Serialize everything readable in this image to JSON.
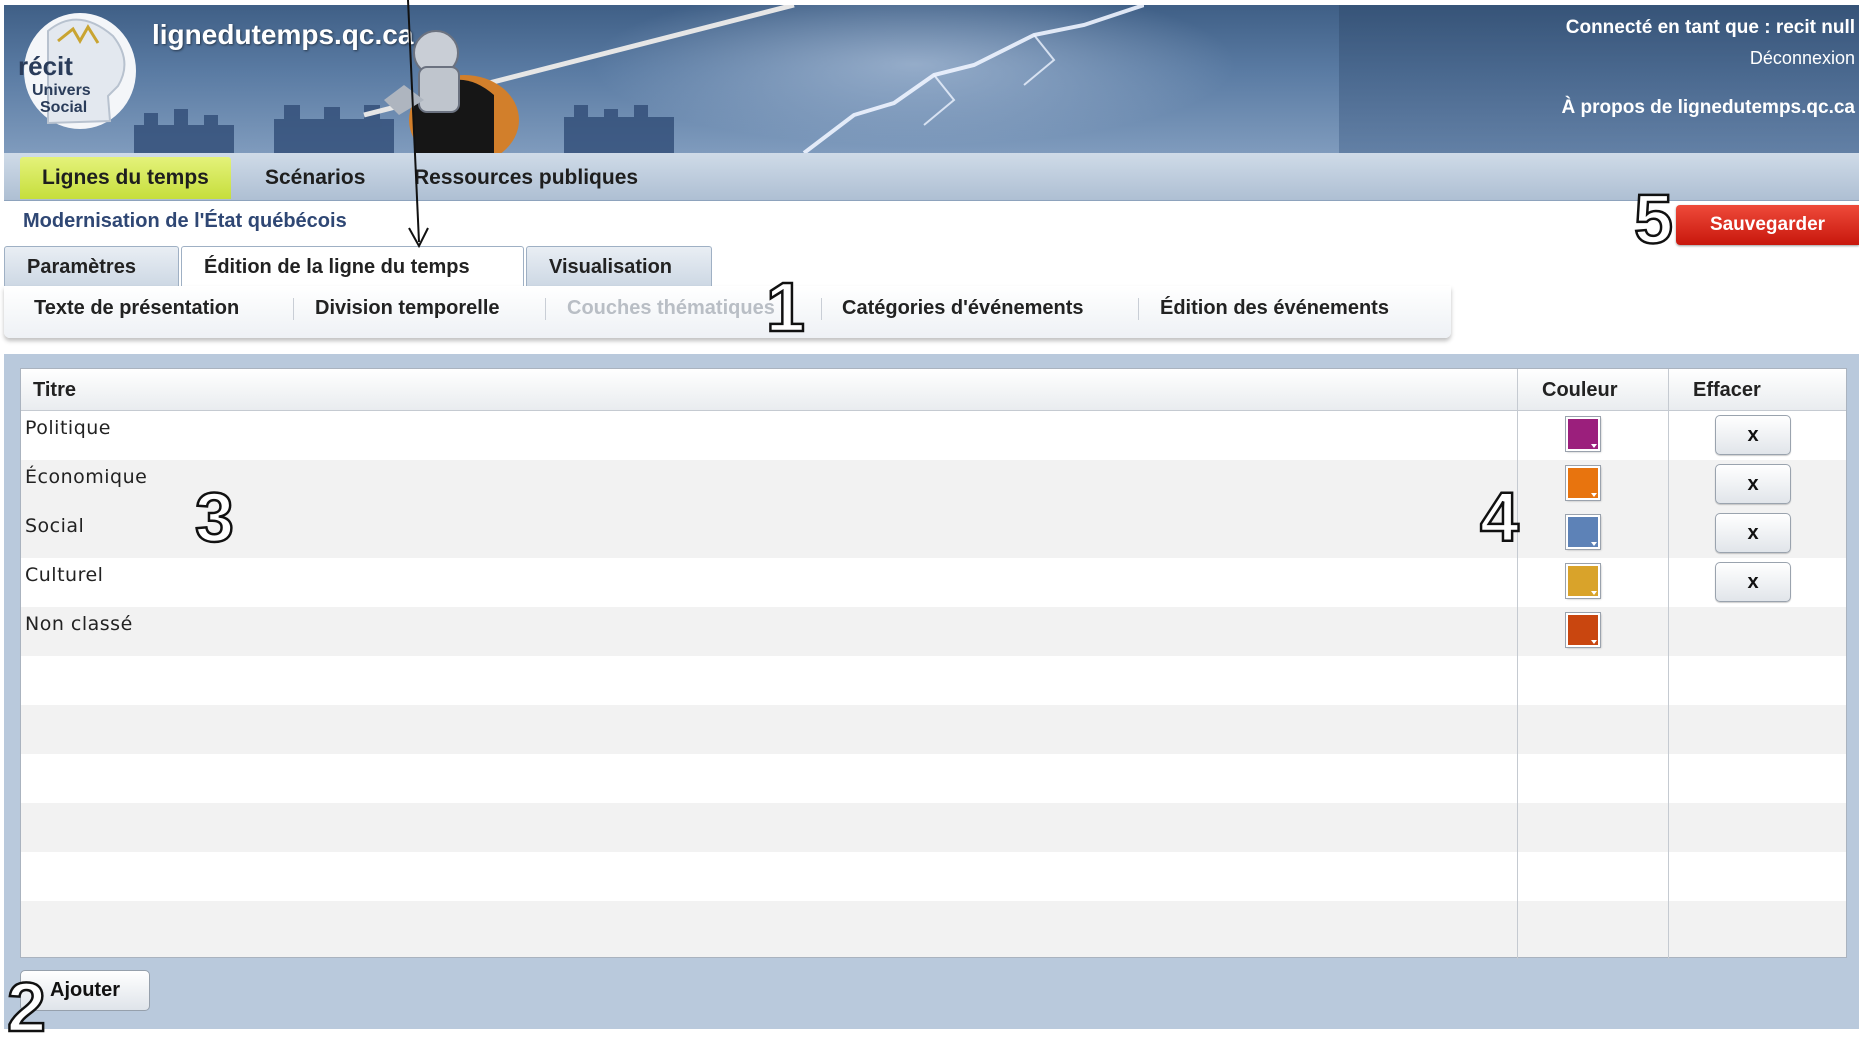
{
  "header": {
    "site_title": "lignedutemps.qc.ca",
    "logo": {
      "brand": "récit",
      "line1": "Univers",
      "line2": "Social"
    },
    "connected_as": "Connecté en tant que : recit null",
    "logout": "Déconnexion",
    "about": "À propos de lignedutemps.qc.ca"
  },
  "main_nav": {
    "items": [
      {
        "label": "Lignes du temps",
        "active": true
      },
      {
        "label": "Scénarios",
        "active": false
      },
      {
        "label": "Ressources publiques",
        "active": false
      }
    ]
  },
  "project": {
    "title": "Modernisation de l'État québécois",
    "save_label": "Sauvegarder"
  },
  "tabs": [
    {
      "label": "Paramètres",
      "active": false
    },
    {
      "label": "Édition de la ligne du temps",
      "active": true
    },
    {
      "label": "Visualisation",
      "active": false
    }
  ],
  "subtabs": [
    {
      "label": "Texte de présentation",
      "disabled": false
    },
    {
      "label": "Division temporelle",
      "disabled": false
    },
    {
      "label": "Couches thématiques",
      "disabled": true
    },
    {
      "label": "Catégories d'événements",
      "disabled": false
    },
    {
      "label": "Édition des événements",
      "disabled": false
    }
  ],
  "grid": {
    "columns": [
      "Titre",
      "Couleur",
      "Effacer"
    ],
    "rows": [
      {
        "title": "Politique",
        "color": "#9b1f7c",
        "deletable": true,
        "delete_label": "x"
      },
      {
        "title": "Économique",
        "color": "#e8740e",
        "deletable": true,
        "delete_label": "x"
      },
      {
        "title": "Social",
        "color": "#5d82b7",
        "deletable": true,
        "delete_label": "x"
      },
      {
        "title": "Culturel",
        "color": "#d9a32a",
        "deletable": true,
        "delete_label": "x"
      },
      {
        "title": "Non classé",
        "color": "#c9460f",
        "deletable": false,
        "delete_label": ""
      }
    ]
  },
  "add_label": "Ajouter",
  "annotations": [
    "1",
    "2",
    "3",
    "4",
    "5"
  ],
  "colors": {
    "nav_active": "#c6de3c",
    "save": "#d32011",
    "header_blue": "#4b6a92",
    "panel": "#b9c9dc"
  }
}
